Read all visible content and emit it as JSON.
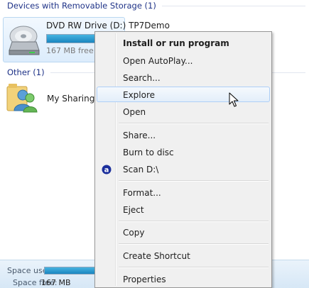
{
  "background": {
    "groups": {
      "removable_header": "Devices with Removable Storage (1)",
      "other_header": "Other (1)"
    },
    "drive": {
      "name": "DVD RW Drive (D:) TP7Demo",
      "free_text": "167 MB free",
      "used_fraction": 0.95,
      "icon": "dvd-drive-icon"
    },
    "share": {
      "name": "My Sharing",
      "icon": "sharing-users-icon"
    },
    "details": {
      "space_used_label": "Space used:",
      "space_free_label": "Space free:",
      "space_free_value": "167 MB"
    }
  },
  "context_menu": {
    "items": [
      {
        "label": "Install or run program",
        "bold": true
      },
      {
        "label": "Open AutoPlay..."
      },
      {
        "label": "Search..."
      },
      {
        "label": "Explore",
        "hover": true
      },
      {
        "label": "Open"
      },
      {
        "label": "Share..."
      },
      {
        "label": "Burn to disc"
      },
      {
        "label": "Scan D:\\",
        "icon": "antivirus-icon"
      },
      {
        "label": "Format..."
      },
      {
        "label": "Eject"
      },
      {
        "label": "Copy"
      },
      {
        "label": "Create Shortcut"
      },
      {
        "label": "Properties"
      }
    ]
  },
  "colors": {
    "accent_blue": "#1a86c0",
    "header_blue": "#1e3287",
    "menu_hover_border": "#aecff7"
  }
}
